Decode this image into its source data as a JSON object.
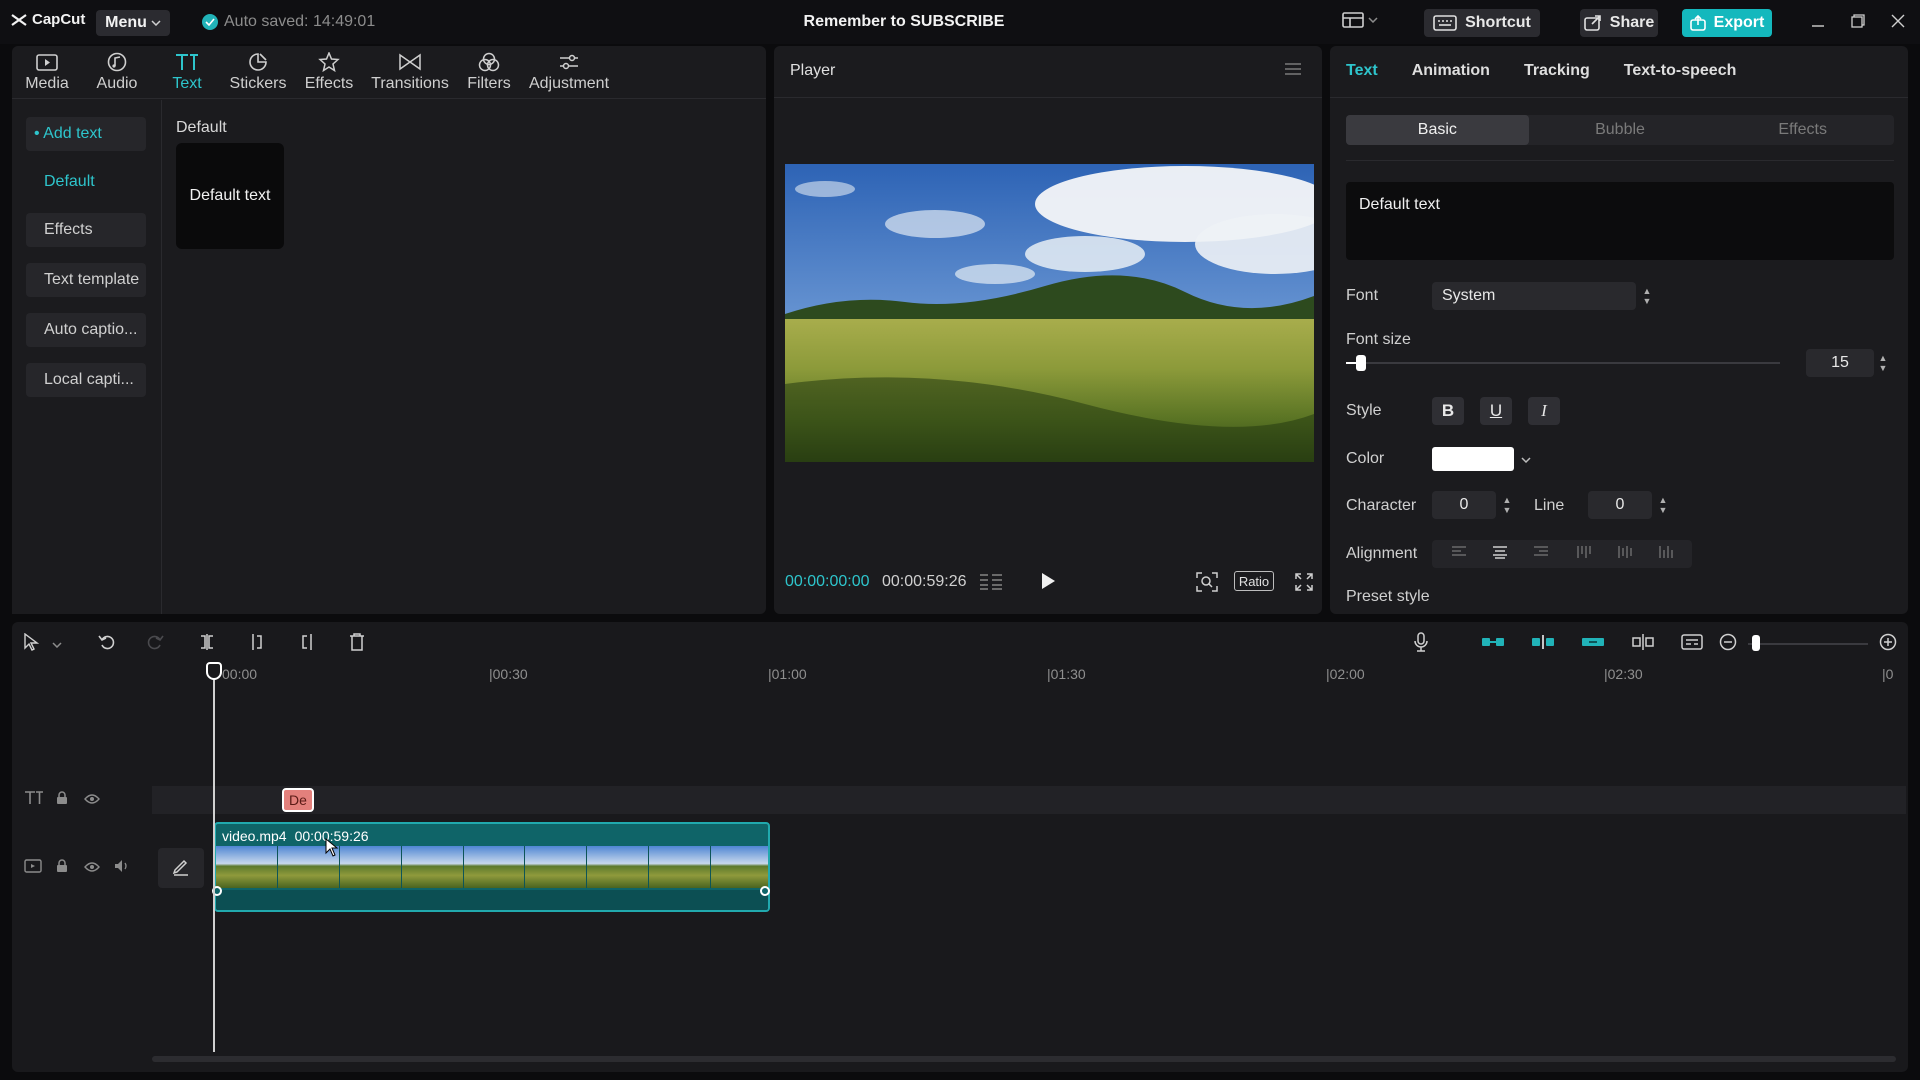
{
  "app": {
    "name": "CapCut",
    "menu_label": "Menu",
    "autosave_text": "Auto saved: 14:49:01",
    "project_title": "Remember to SUBSCRIBE",
    "shortcut_label": "Shortcut",
    "share_label": "Share",
    "export_label": "Export",
    "accent_color": "#2ec5cc"
  },
  "media_tabs": [
    {
      "label": "Media",
      "icon": "media-icon"
    },
    {
      "label": "Audio",
      "icon": "audio-icon"
    },
    {
      "label": "Text",
      "icon": "text-icon",
      "active": true
    },
    {
      "label": "Stickers",
      "icon": "stickers-icon"
    },
    {
      "label": "Effects",
      "icon": "effects-icon"
    },
    {
      "label": "Transitions",
      "icon": "transitions-icon"
    },
    {
      "label": "Filters",
      "icon": "filters-icon"
    },
    {
      "label": "Adjustment",
      "icon": "adjustment-icon"
    }
  ],
  "side_menu": {
    "add_text": "• Add text",
    "default": "Default",
    "effects": "Effects",
    "text_template": "Text template",
    "auto_captions": "Auto captio...",
    "local_captions": "Local capti..."
  },
  "content": {
    "section_title": "Default",
    "card_text": "Default text"
  },
  "player": {
    "title": "Player",
    "current_time": "00:00:00:00",
    "total_time": "00:00:59:26",
    "ratio_label": "Ratio"
  },
  "props": {
    "tabs": [
      "Text",
      "Animation",
      "Tracking",
      "Text-to-speech"
    ],
    "subtabs": [
      "Basic",
      "Bubble",
      "Effects"
    ],
    "text_value": "Default text",
    "font_label": "Font",
    "font_value": "System",
    "font_size_label": "Font size",
    "font_size_value": "15",
    "font_size_fraction": 0.035,
    "style_label": "Style",
    "style_buttons": [
      "B",
      "U",
      "I"
    ],
    "color_label": "Color",
    "color_value": "#ffffff",
    "character_label": "Character",
    "character_value": "0",
    "line_label": "Line",
    "line_value": "0",
    "alignment_label": "Alignment",
    "preset_label": "Preset style"
  },
  "timeline": {
    "ruler_labels": [
      "00:00",
      "|00:30",
      "|01:00",
      "|01:30",
      "|02:00",
      "|02:30",
      "|0"
    ],
    "text_clip_label": "De",
    "video_clip_name": "video.mp4",
    "video_clip_duration": "00:00:59:26"
  }
}
